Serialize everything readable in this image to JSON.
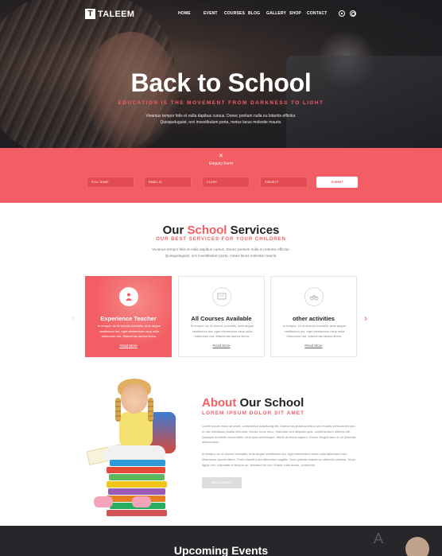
{
  "brand": {
    "logo_mark": "T",
    "name": "TALEEM"
  },
  "nav": {
    "items": [
      "HOME",
      "EVENT",
      "COURSES",
      "BLOG",
      "GALLERY",
      "SHOP",
      "CONTACT"
    ],
    "icons": [
      "cart-icon",
      "search-icon"
    ]
  },
  "hero": {
    "title": "Back to School",
    "subtitle": "EDUCATION IS THE MOVEMENT FROM DARKNESS TO LIGHT",
    "text": "Vivamus tempor felis et nulla dapibus cursus. Donec pretium nulla eu lobortis efficitur. Quisqueluguist, orci investibulum porta, metus lacus molestie mauris."
  },
  "enquiry": {
    "close_glyph": "✕",
    "title": "Enquiry Form",
    "fields": [
      "FULL NAME",
      "EMAIL ID",
      "CLASS",
      "SUBJECT"
    ],
    "submit": "SUBMIT"
  },
  "services": {
    "title_pre": "Our ",
    "title_accent": "School",
    "title_post": " Services",
    "subtitle": "OUR BEST SERVICES FOR YOUR CHILDREN",
    "text": "Vivamus tempor felis et nulla dapibus cursus. Donec pretium nulla eu lobortis efficitur. Quisqueluguist, orci investibulum porta, metus lacus molestie mauris.",
    "cards": [
      {
        "title": "Experience Teacher",
        "icon": "teacher-icon",
        "text": "In tempor, ex id viverra convallis, ante augue vestibulum leo, eget elementum risus nulla bibendum nisl. Maecenas lacinia libero.",
        "link": "Read More"
      },
      {
        "title": "All Courses Available",
        "icon": "courses-icon",
        "text": "In tempor, ex id viverra convallis, ante augue vestibulum leo, eget elementum risus nulla bibendum nisl. Maecenas lacinia libero.",
        "link": "Read More"
      },
      {
        "title": "other activities",
        "icon": "activities-icon",
        "text": "In tempor, ex id viverra convallis, ante augue vestibulum leo, eget elementum risus nulla bibendum nisl. Maecenas lacinia libero.",
        "link": "Read More"
      }
    ],
    "arrow_left": "‹",
    "arrow_right": "›"
  },
  "about": {
    "title_accent": "About",
    "title_rest": " Our School",
    "subtitle": "LOREM IPSUM DOLOR SIT AMET",
    "p1": "Lorem ipsum dolor sit amet, consectetur adipiscing elit. Maecenas pulvinar tellus sed mauris vehicula tempor. In hac habitasse platea dictumst. Donec nunc nunc, interdum sed aliquam quis, condimentum ultrices elit. Quisque molestie consectetur urna quis scelerisque. Morbi at lectus sapien. Donec feugiat arcu in mi placerat ullamcorper.",
    "p2": "In tempor, ex id viverra convallis, ante augue vestibulum leo, eget elementum risus nulla bibendum nisl. Maecenas lacinia libero. Proin blandit justo bibendum sagittis. Duis gravida massa ac vehicula pulvinar. Nunc ligula orci, vulputate id tempor ac, tincidunt eu orci. Etiam nulla lectus, commodo.",
    "button": "READ MORE"
  },
  "events": {
    "title": "Upcoming Events"
  },
  "colors": {
    "accent": "#f25e64",
    "dark": "#27262a"
  }
}
